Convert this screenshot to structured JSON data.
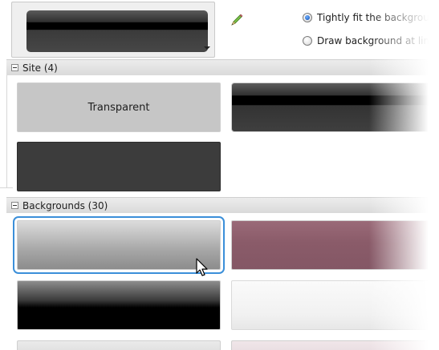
{
  "options": {
    "tight_fit_label": "Tightly fit the background",
    "draw_at_limits_label": "Draw background at limits",
    "tight_fit_selected": true
  },
  "groups": {
    "site": {
      "label": "Site (4)"
    },
    "backgrounds": {
      "label": "Backgrounds (30)"
    }
  },
  "site_tiles": [
    {
      "label": "Transparent",
      "style": "transparent"
    },
    {
      "label": "",
      "style": "site-stripe"
    },
    {
      "label": "",
      "style": "dark"
    }
  ],
  "background_tiles": [
    {
      "label": "",
      "style": "gray-gradient",
      "selected": true
    },
    {
      "label": "",
      "style": "mauve"
    },
    {
      "label": "",
      "style": "black-gradient"
    },
    {
      "label": "",
      "style": "white-gradient"
    }
  ],
  "icons": {
    "edit": "pencil-icon",
    "cursor": "mouse-pointer-icon",
    "dropdown": "chevron-down-icon",
    "collapse": "collapse-toggle-icon"
  },
  "colors": {
    "selection_outline": "#3b8fd9",
    "group_header_bg": "#e3e3e3"
  }
}
